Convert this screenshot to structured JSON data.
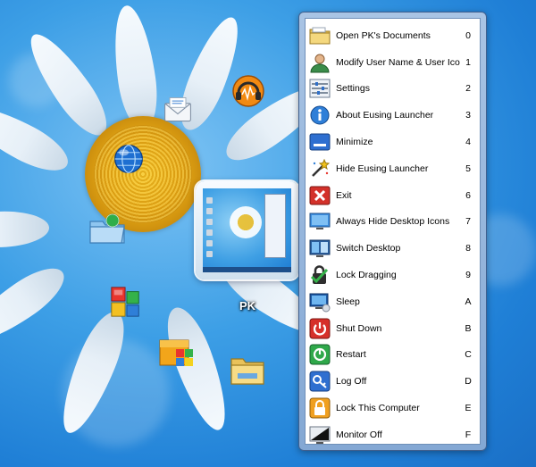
{
  "desktop": {
    "preview_label": "PK"
  },
  "menu": {
    "items": [
      {
        "label": "Open PK's Documents",
        "key": "0",
        "icon": "folder-documents-icon"
      },
      {
        "label": "Modify User Name & User Icon",
        "key": "1",
        "icon": "user-icon"
      },
      {
        "label": "Settings",
        "key": "2",
        "icon": "settings-sliders-icon"
      },
      {
        "label": "About Eusing Launcher",
        "key": "3",
        "icon": "info-icon"
      },
      {
        "label": "Minimize",
        "key": "4",
        "icon": "minimize-icon"
      },
      {
        "label": "Hide Eusing Launcher",
        "key": "5",
        "icon": "magic-wand-icon"
      },
      {
        "label": "Exit",
        "key": "6",
        "icon": "exit-x-icon"
      },
      {
        "label": "Always Hide Desktop Icons",
        "key": "7",
        "icon": "desktop-icon"
      },
      {
        "label": "Switch Desktop",
        "key": "8",
        "icon": "switch-desktop-icon"
      },
      {
        "label": "Lock Dragging",
        "key": "9",
        "icon": "lock-dragging-icon"
      },
      {
        "label": "Sleep",
        "key": "A",
        "icon": "sleep-monitor-icon"
      },
      {
        "label": "Shut Down",
        "key": "B",
        "icon": "power-icon"
      },
      {
        "label": "Restart",
        "key": "C",
        "icon": "restart-icon"
      },
      {
        "label": "Log Off",
        "key": "D",
        "icon": "log-off-key-icon"
      },
      {
        "label": "Lock This Computer",
        "key": "E",
        "icon": "padlock-icon"
      },
      {
        "label": "Monitor Off",
        "key": "F",
        "icon": "monitor-off-icon"
      }
    ]
  },
  "colors": {
    "desktop_blue": "#2f8fe0",
    "menu_frame": "#84a8d4",
    "menu_bg": "#ffffff"
  }
}
